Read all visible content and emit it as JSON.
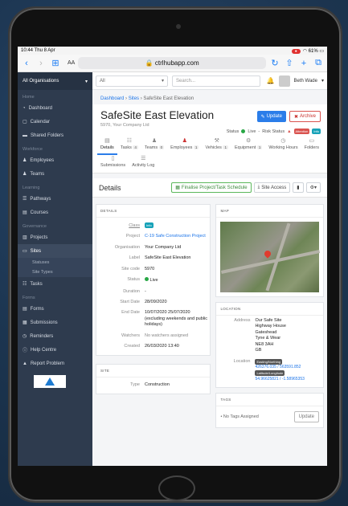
{
  "device_status": {
    "time": "10:44",
    "date": "Thu 8 Apr",
    "battery": "61%"
  },
  "browser": {
    "text_size": "AA",
    "url": "ctrlhubapp.com"
  },
  "sidebar": {
    "org": "All Organisations",
    "sections": {
      "home": "Home",
      "workforce": "Workforce",
      "learning": "Learning",
      "governance": "Governance",
      "forms": "Forms"
    },
    "items": {
      "dashboard": "Dashboard",
      "calendar": "Calendar",
      "shared": "Shared Folders",
      "employees": "Employees",
      "teams": "Teams",
      "pathways": "Pathways",
      "courses": "Courses",
      "projects": "Projects",
      "sites": "Sites",
      "statuses": "Statuses",
      "site_types": "Site Types",
      "tasks": "Tasks",
      "forms": "Forms",
      "submissions": "Submissions",
      "reminders": "Reminders",
      "help": "Help Centre",
      "report": "Report Problem"
    }
  },
  "topbar": {
    "filter": "All",
    "search_placeholder": "Search...",
    "user": "Beth Wade"
  },
  "breadcrumb": {
    "dashboard": "Dashboard",
    "sites": "Sites",
    "current": "SafeSite East Elevation"
  },
  "header": {
    "title": "SafeSite East Elevation",
    "meta": "5970, Your Company Ltd",
    "update": "Update",
    "archive": "Archive",
    "status_label": "Status",
    "status_value": "Live",
    "risk_label": "Risk Status",
    "risk_badge": "Attention",
    "info_badge": "Info"
  },
  "tabs": [
    {
      "label": "Details",
      "count": ""
    },
    {
      "label": "Tasks",
      "count": "4"
    },
    {
      "label": "Teams",
      "count": "0"
    },
    {
      "label": "Employees",
      "count": "1"
    },
    {
      "label": "Vehicles",
      "count": "1"
    },
    {
      "label": "Equipment",
      "count": "1"
    },
    {
      "label": "Working Hours",
      "count": ""
    },
    {
      "label": "Folders",
      "count": ""
    },
    {
      "label": "Submissions",
      "count": ""
    },
    {
      "label": "Activity Log",
      "count": ""
    }
  ],
  "details_bar": {
    "title": "Details",
    "finalise": "Finalise Project/Task Schedule",
    "site_access": "Site Access"
  },
  "details": {
    "heading": "DETAILS",
    "rows": [
      {
        "k": "Class",
        "v": "Info"
      },
      {
        "k": "Project",
        "v": "C-19 Safe Construction Project"
      },
      {
        "k": "Organisation",
        "v": "Your Company Ltd"
      },
      {
        "k": "Label",
        "v": "SafeSite East Elevation"
      },
      {
        "k": "Site code",
        "v": "5970"
      },
      {
        "k": "Status",
        "v": "Live"
      },
      {
        "k": "Duration",
        "v": "-"
      },
      {
        "k": "Start Date",
        "v": "28/09/2020"
      },
      {
        "k": "End Date",
        "v": "10/07/2020 25/07/2020 (excluding weekends and public holidays)"
      },
      {
        "k": "Watchers",
        "v": "No watchers assigned"
      },
      {
        "k": "Created",
        "v": "26/03/2020 13:40"
      }
    ],
    "site_heading": "SITE",
    "type_label": "Type",
    "type_value": "Construction"
  },
  "map": {
    "heading": "MAP"
  },
  "location": {
    "heading": "LOCATION",
    "address_label": "Address",
    "address": [
      "Our Safe Site",
      "Highway House",
      "Gateshead",
      "Tyne & Wear",
      "NE8 3AH",
      "GB"
    ],
    "location_label": "Location",
    "easting_label": "Easting/Northing",
    "easting": "426376.035 / 563591.852",
    "latlng_label": "Latitude/Longitude",
    "latlng": "54.96625821 / -1.58965353"
  },
  "tags": {
    "heading": "TAGS",
    "empty": "No Tags Assigned",
    "update": "Update"
  }
}
